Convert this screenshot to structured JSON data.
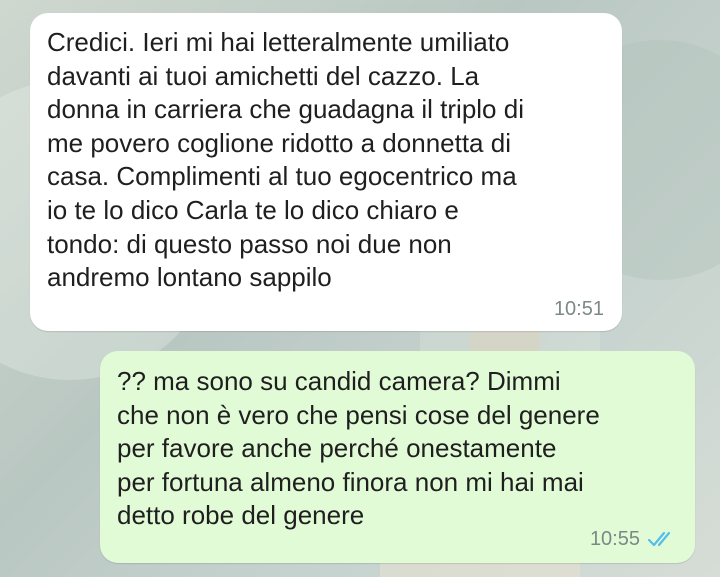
{
  "conversation": {
    "incoming": {
      "text": "Credici. Ieri mi hai letteralmente umiliato\ndavanti ai tuoi amichetti del cazzo. La\ndonna in carriera che guadagna il triplo di\nme povero coglione ridotto a donnetta di\ncasa. Complimenti al tuo egocentrico ma\nio te lo dico Carla te lo dico chiaro e\ntondo: di questo passo noi due non\nandremo lontano sappilo",
      "time": "10:51"
    },
    "outgoing": {
      "text": "?? ma sono su candid camera? Dimmi\nche non è vero che pensi cose del genere\nper favore anche perché onestamente\nper fortuna almeno finora non mi hai mai\ndetto robe del genere",
      "time": "10:55",
      "status": "read",
      "status_icon": "double-check-icon",
      "status_color": "#53bdeb"
    }
  },
  "colors": {
    "incoming_bubble": "#ffffff",
    "outgoing_bubble": "#e2fbd7",
    "text": "#1f1f1f",
    "timestamp": "#7b8a86"
  }
}
